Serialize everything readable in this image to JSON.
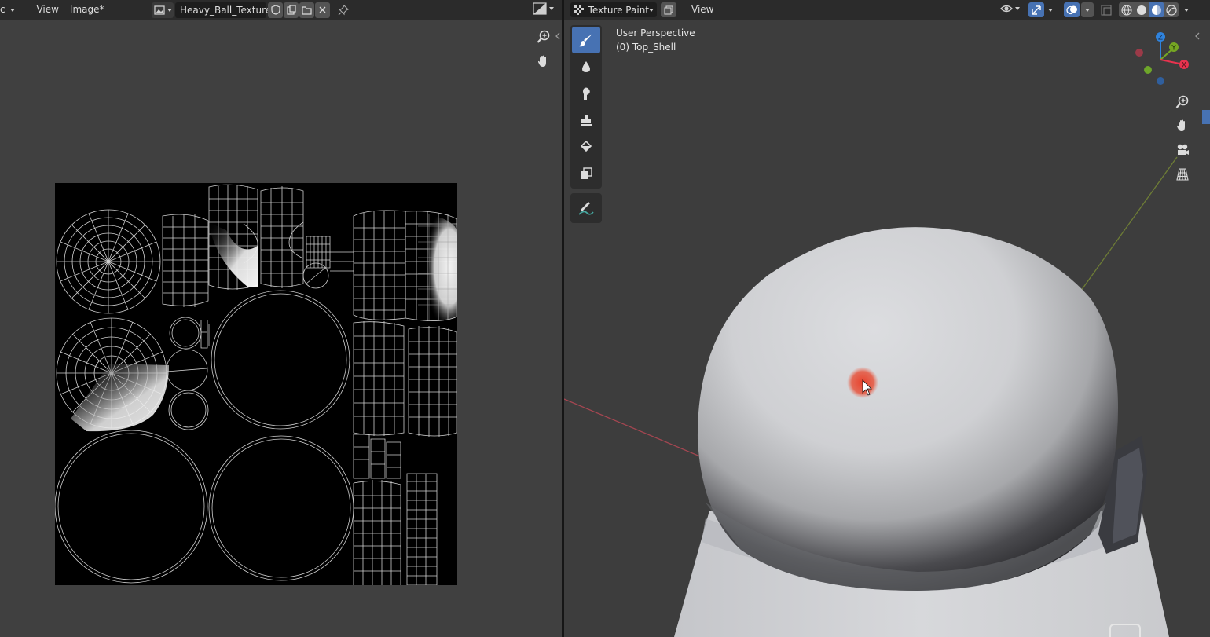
{
  "image_editor": {
    "header": {
      "mode_menu": "c",
      "menu": [
        "View",
        "Image*"
      ],
      "image_name": "Heavy_Ball_Texture..."
    }
  },
  "viewport": {
    "header": {
      "mode": "Texture Paint",
      "menu": [
        "View"
      ]
    },
    "info": {
      "perspective": "User Perspective",
      "object": "(0) Top_Shell"
    },
    "gizmo": {
      "x_label": "X",
      "y_label": "Y",
      "z_label": "Z",
      "x_color": "#e8334f",
      "y_color": "#75a623",
      "z_color": "#2f83dd"
    },
    "tools": [
      "draw-brush",
      "soften-brush",
      "smear-brush",
      "clone-brush",
      "fill-brush",
      "mask-brush",
      "annotate"
    ],
    "active_tool": "draw-brush"
  },
  "colors": {
    "accent": "#4772b3",
    "header_bg": "#2b2b2b",
    "editor_bg": "#404040",
    "viewport_bg": "#3d3d3d",
    "brush_cursor": "#e8402a"
  }
}
